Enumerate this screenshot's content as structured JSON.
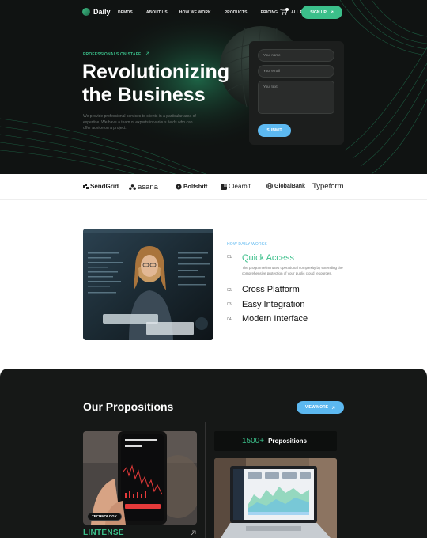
{
  "nav": {
    "logo": "Daily",
    "links": [
      "DEMOS",
      "ABOUT US",
      "HOW WE WORK",
      "PRODUCTS",
      "PRICING",
      "ALL PAGES"
    ],
    "signup": "SIGN UP",
    "cart_icon": "cart-icon"
  },
  "hero": {
    "eyebrow": "PROFESSIONALS ON STAFF",
    "title_line1": "Revolutionizing",
    "title_line2": "the Business",
    "description": "We provide professional services to clients in a particular area of expertise. We have a team of experts in various fields who can offer advice on a project."
  },
  "form": {
    "name_placeholder": "Your name",
    "email_placeholder": "Your email",
    "text_placeholder": "Your text",
    "submit": "SUBMIT"
  },
  "brands": [
    "SendGrid",
    "asana",
    "Boltshift",
    "Clearbit",
    "GlobalBank",
    "Typeform"
  ],
  "how": {
    "label": "HOW DAILY WORKS",
    "steps": [
      {
        "num": "01/",
        "title": "Quick Access",
        "desc": "The program eliminates operational complexity by extending the comprehensive protection of your public cloud resources."
      },
      {
        "num": "02/",
        "title": "Cross Platform"
      },
      {
        "num": "03/",
        "title": "Easy Integration"
      },
      {
        "num": "04/",
        "title": "Modern Interface"
      }
    ]
  },
  "props": {
    "title": "Our Propositions",
    "view_more": "VIEW MORE",
    "card_tag": "TECHNOLOGY",
    "card_name": "LINTENSE",
    "stat_number": "1500+",
    "stat_label": "Propositions"
  },
  "colors": {
    "accent_green": "#3bbf8a",
    "accent_blue": "#5cb8f0",
    "dark_bg": "#101312"
  }
}
